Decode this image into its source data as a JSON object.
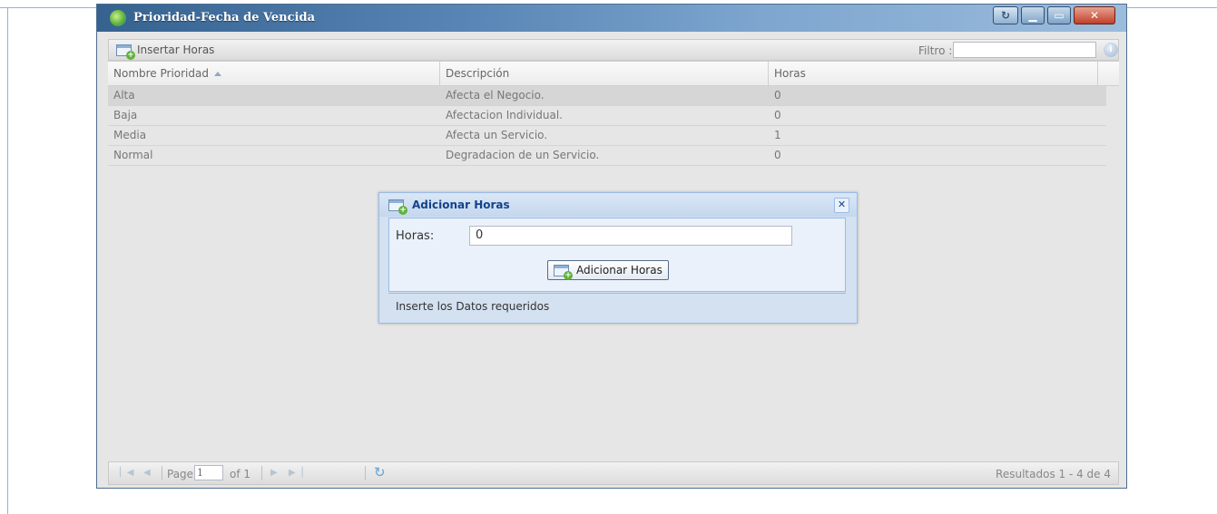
{
  "window": {
    "title": "Prioridad-Fecha de Vencida"
  },
  "toolbar": {
    "insert_label": "Insertar Horas",
    "filter_label": "Filtro :",
    "filter_value": ""
  },
  "grid": {
    "columns": [
      "Nombre Prioridad",
      "Descripción",
      "Horas"
    ],
    "rows": [
      {
        "nombre": "Alta",
        "descripcion": "Afecta el Negocio.",
        "horas": "0"
      },
      {
        "nombre": "Baja",
        "descripcion": "Afectacion Individual.",
        "horas": "0"
      },
      {
        "nombre": "Media",
        "descripcion": "Afecta un Servicio.",
        "horas": "1"
      },
      {
        "nombre": "Normal",
        "descripcion": "Degradacion de un Servicio.",
        "horas": "0"
      }
    ]
  },
  "paging": {
    "page_label": "Page",
    "page_value": "1",
    "of_label": "of 1",
    "results": "Resultados 1 - 4 de 4"
  },
  "dialog": {
    "title": "Adicionar Horas",
    "field_label": "Horas:",
    "field_value": "0",
    "button_label": "Adicionar Horas",
    "status": "Inserte los Datos requeridos"
  }
}
